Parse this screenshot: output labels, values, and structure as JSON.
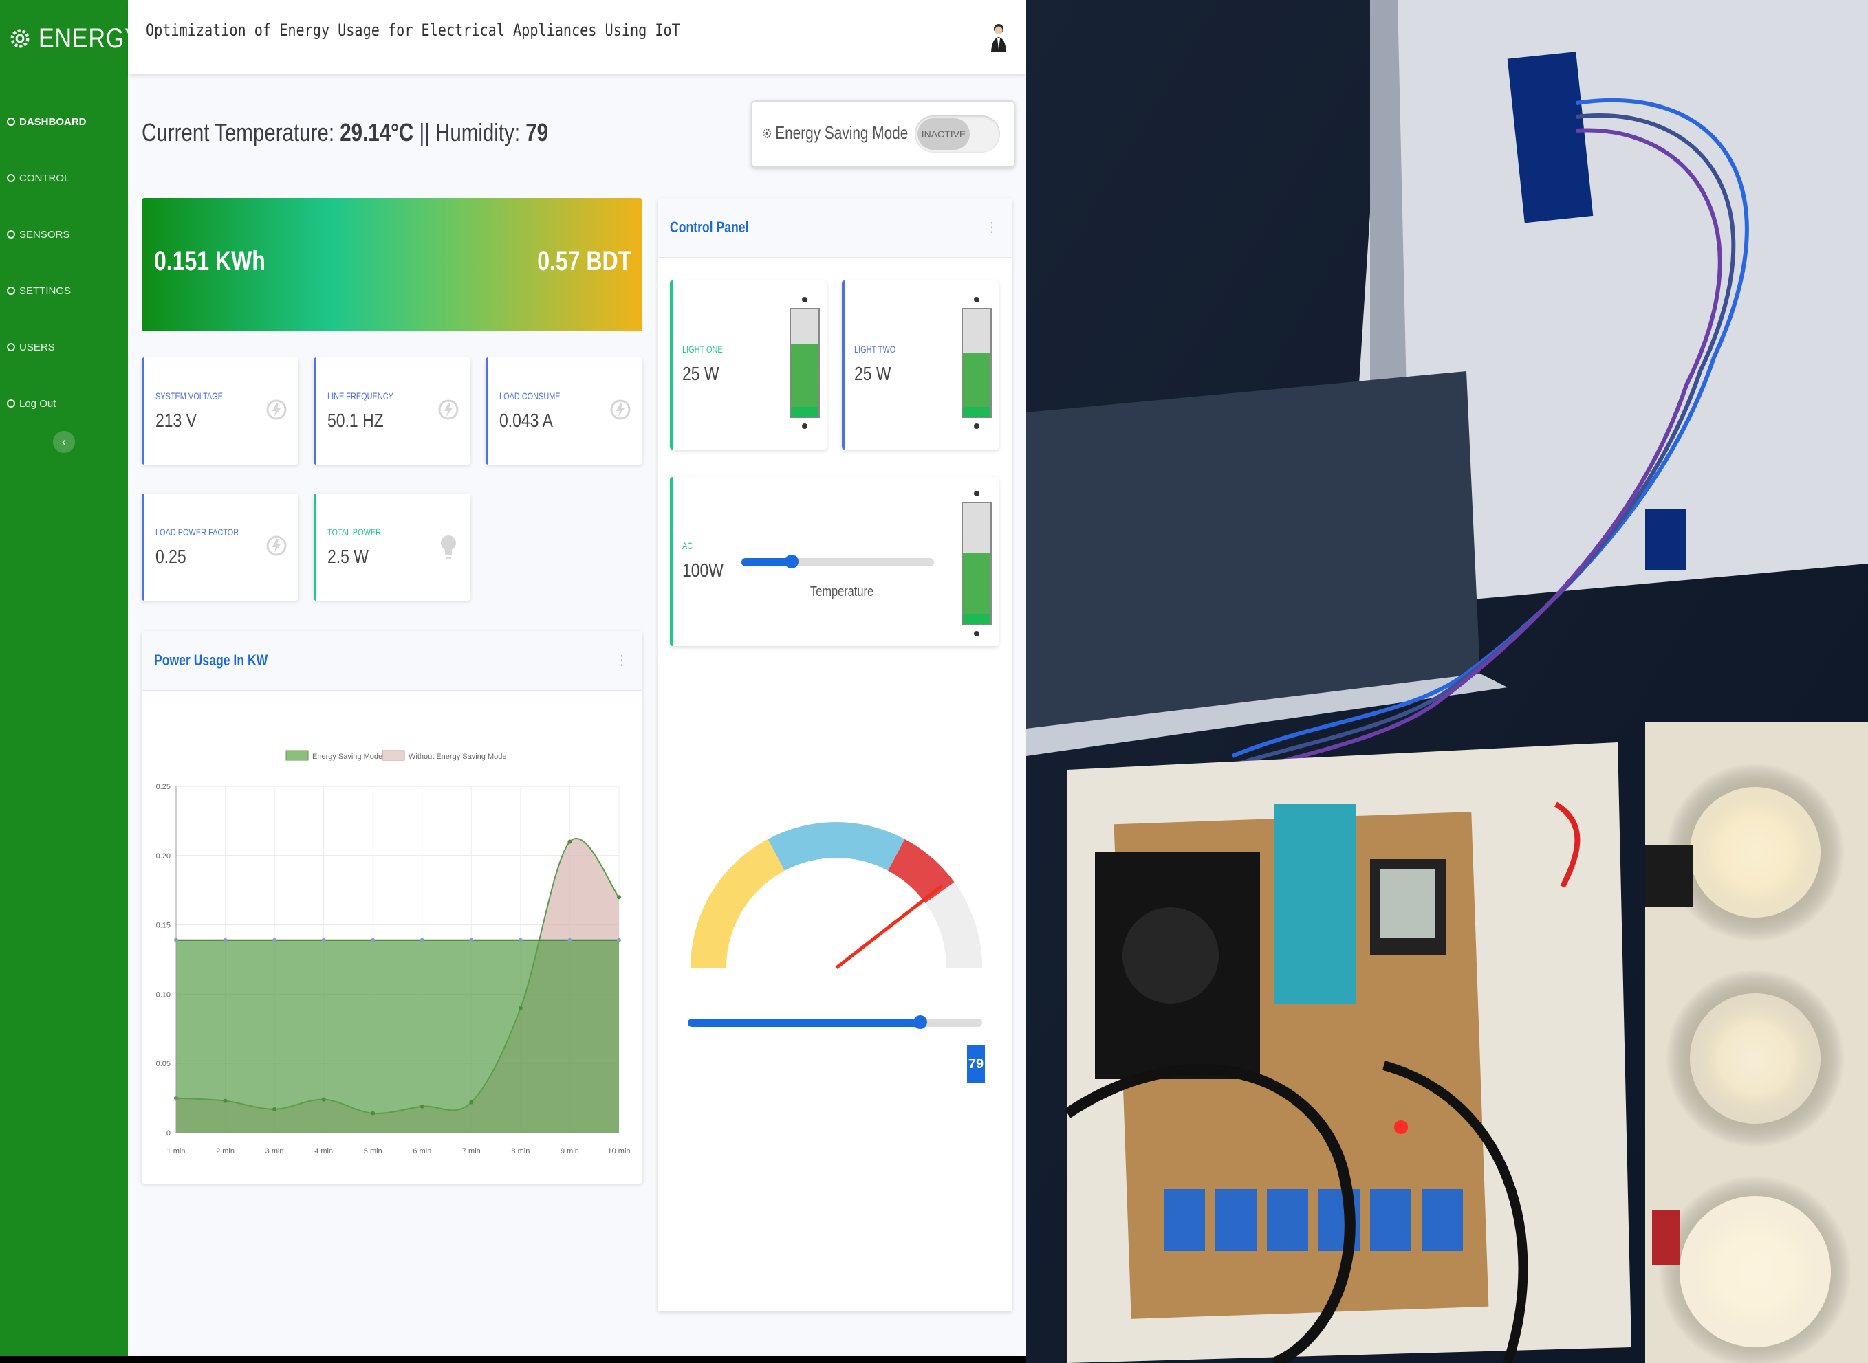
{
  "app": {
    "brand": "ENERGY"
  },
  "sidebar": {
    "items": [
      {
        "label": "DASHBOARD",
        "active": true,
        "icon": "gear-icon"
      },
      {
        "label": "CONTROL",
        "icon": "gear-icon"
      },
      {
        "label": "SENSORS",
        "icon": "gear-icon"
      },
      {
        "label": "SETTINGS",
        "icon": "wrench-icon"
      },
      {
        "label": "USERS",
        "icon": "users-icon"
      },
      {
        "label": "Log Out",
        "icon": "logout-icon"
      }
    ],
    "collapse_icon": "chevron-left-icon"
  },
  "header": {
    "title": "Optimization of Energy Usage for Electrical Appliances Using IoT"
  },
  "environment": {
    "prefix": "Current Temperature:",
    "temperature": "29.14°C",
    "separator": "||",
    "humidity_label": "Humidity:",
    "humidity": "79"
  },
  "energy_saving": {
    "label": "Energy Saving Mode",
    "state": "INACTIVE"
  },
  "banner": {
    "energy": "0.151 KWh",
    "cost": "0.57 BDT",
    "colors": [
      "#0e8c14",
      "#1fc68a",
      "#f0b31a"
    ]
  },
  "stats": [
    {
      "label": "SYSTEM VOLTAGE",
      "value": "213 V",
      "icon": "bolt-icon"
    },
    {
      "label": "LINE FREQUENCY",
      "value": "50.1 HZ",
      "icon": "bolt-icon"
    },
    {
      "label": "LOAD CONSUME",
      "value": "0.043 A",
      "icon": "bolt-icon"
    },
    {
      "label": "LOAD POWER FACTOR",
      "value": "0.25",
      "icon": "bolt-icon"
    },
    {
      "label": "TOTAL POWER",
      "value": "2.5 W",
      "icon": "lightbulb-icon"
    }
  ],
  "power_card": {
    "title": "Power Usage In KW"
  },
  "chart_data": {
    "type": "area",
    "title": "",
    "xlabel": "",
    "ylabel": "",
    "categories": [
      "1 min",
      "2 min",
      "3 min",
      "4 min",
      "5 min",
      "6 min",
      "7 min",
      "8 min",
      "9 min",
      "10 min"
    ],
    "ylim": [
      0,
      0.25
    ],
    "yticks": [
      "0",
      "0.05",
      "0.10",
      "0.15",
      "0.20",
      "0.25"
    ],
    "legend_position": "top",
    "grid": true,
    "series": [
      {
        "name": "Energy Saving Mode",
        "color": "#5a9e4b",
        "values": [
          0.139,
          0.139,
          0.139,
          0.139,
          0.139,
          0.139,
          0.139,
          0.139,
          0.139,
          0.139
        ]
      },
      {
        "name": "Without Energy Saving Mode",
        "color": "#d9b9b4",
        "values": [
          0.025,
          0.023,
          0.017,
          0.024,
          0.014,
          0.019,
          0.022,
          0.09,
          0.21,
          0.17
        ]
      }
    ]
  },
  "control_panel": {
    "title": "Control Panel",
    "lights": [
      {
        "label": "LIGHT ONE",
        "value": "25 W",
        "level": 0.65
      },
      {
        "label": "LIGHT TWO",
        "value": "25 W",
        "level": 0.55
      }
    ],
    "ac": {
      "label": "AC",
      "value": "100W",
      "slider_caption": "Temperature",
      "slider_level": 0.26,
      "switch_level": 0.55
    },
    "gauge": {
      "value": "79",
      "slider_level": 0.79,
      "colors": [
        "#fbd96a",
        "#7ec8e3",
        "#e34848",
        "#eeeeee"
      ]
    }
  }
}
